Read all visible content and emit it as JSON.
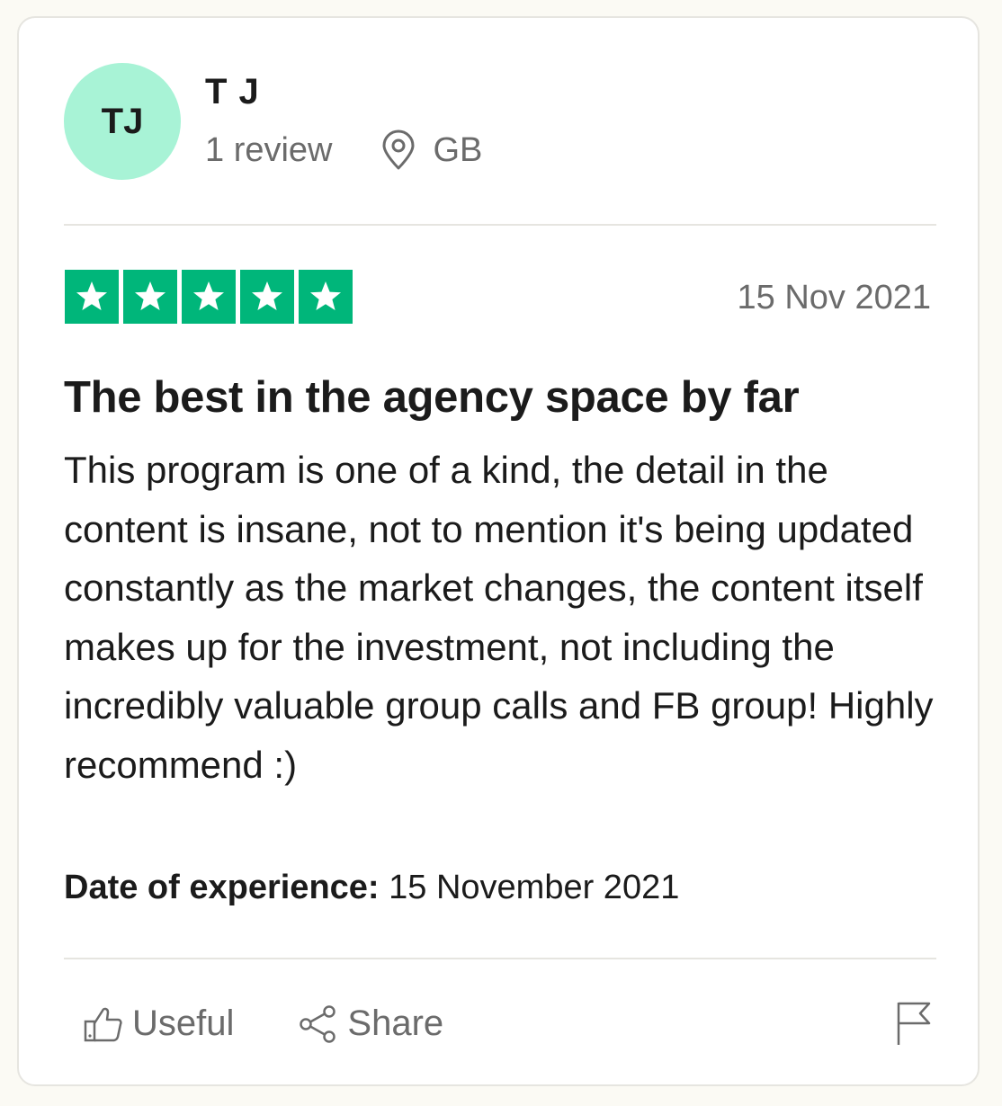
{
  "reviewer": {
    "initials": "TJ",
    "name": "T J",
    "review_count": "1 review",
    "country": "GB",
    "avatar_color": "#a8f3d6"
  },
  "review": {
    "rating": 5,
    "rating_max": 5,
    "star_color": "#00b67a",
    "date": "15 Nov 2021",
    "title": "The best in the agency space by far",
    "body": "This program is one of a kind, the detail in the content is insane, not to mention it's being updated constantly as the market changes, the content itself makes up for the investment, not including the incredibly valuable group calls and FB group! Highly recommend :)",
    "experience_label": "Date of experience:",
    "experience_date": "15 November 2021"
  },
  "actions": {
    "useful_label": "Useful",
    "share_label": "Share",
    "useful_icon": "thumbs-up-icon",
    "share_icon": "share-icon",
    "report_icon": "flag-icon"
  }
}
